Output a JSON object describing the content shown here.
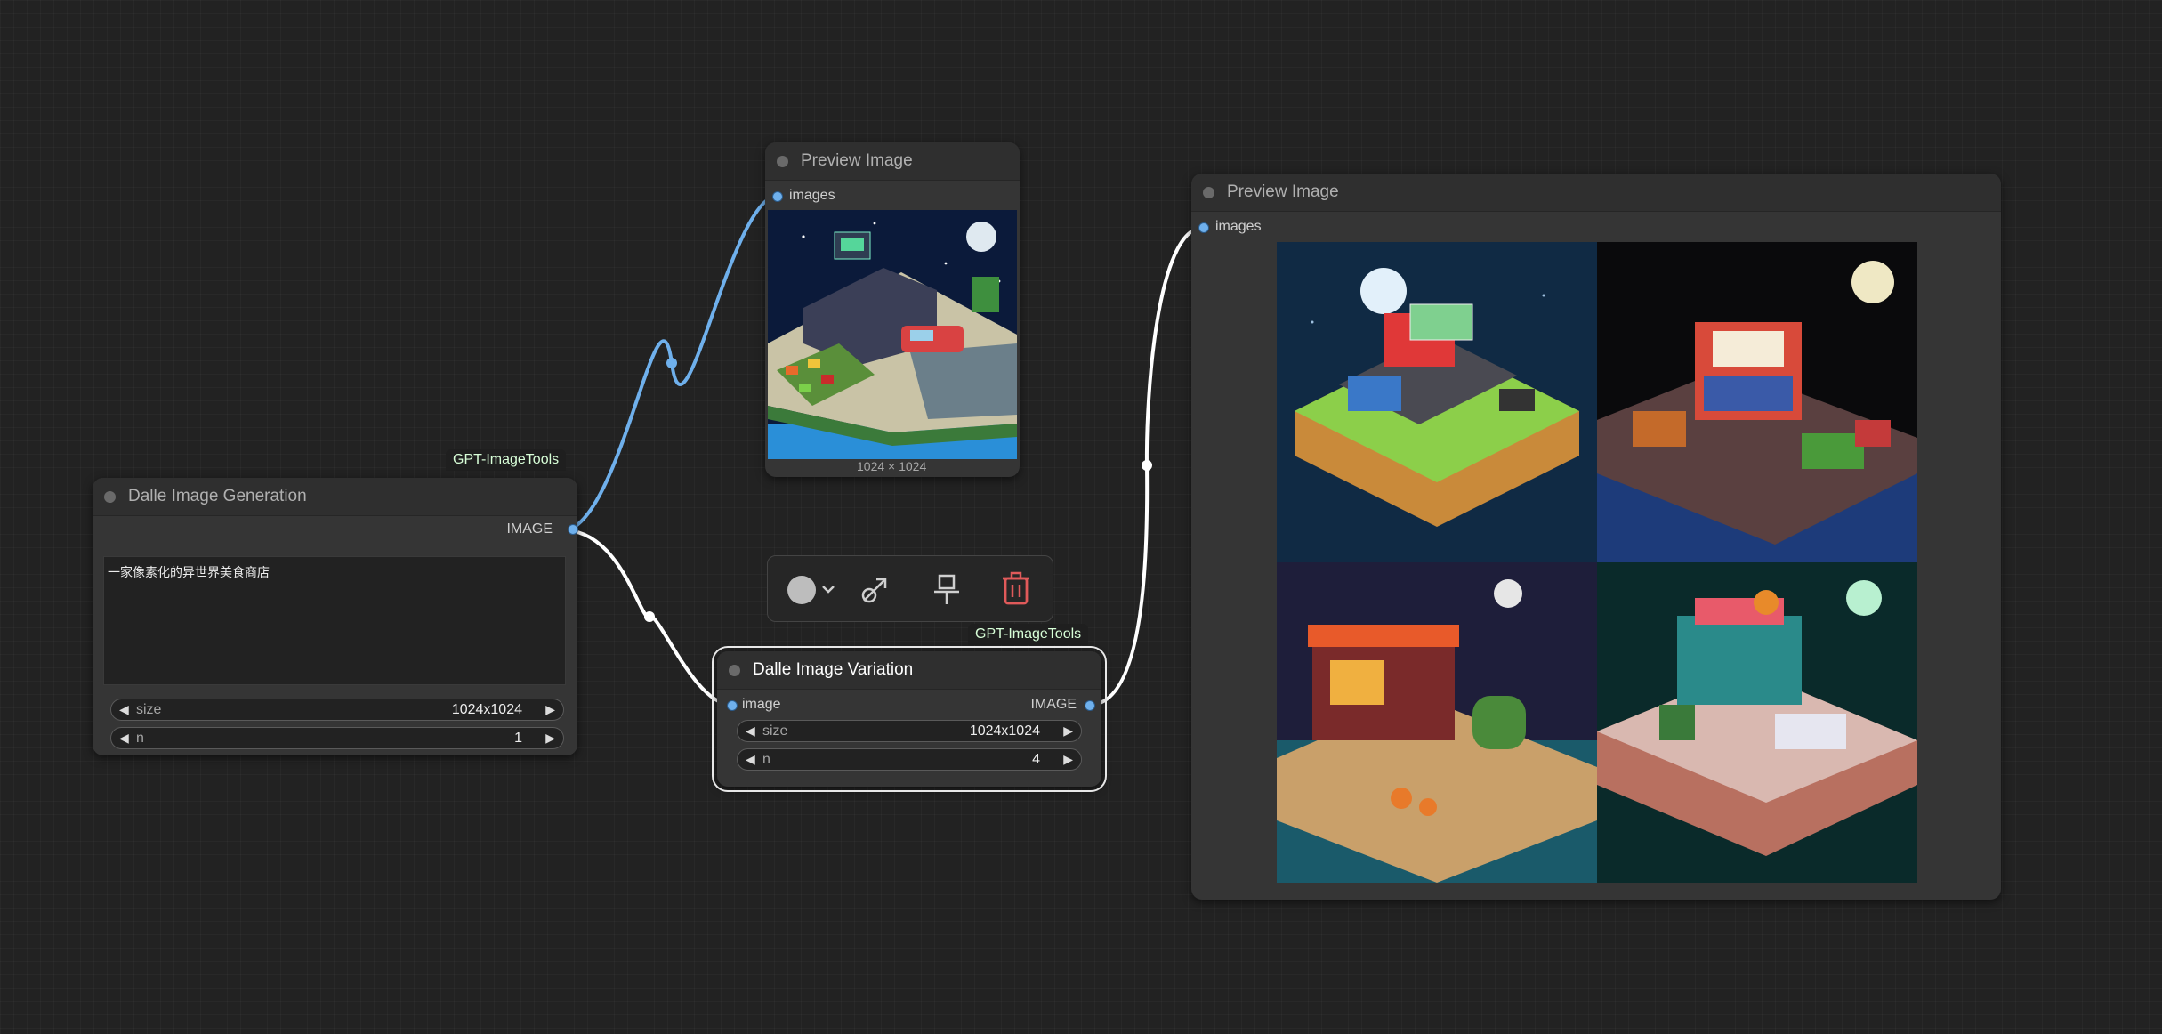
{
  "nodes": {
    "dalle_generation": {
      "title": "Dalle Image Generation",
      "badge": "GPT-ImageTools",
      "output_label": "IMAGE",
      "prompt": "一家像素化的异世界美食商店",
      "widgets": [
        {
          "label": "size",
          "value": "1024x1024"
        },
        {
          "label": "n",
          "value": "1"
        }
      ]
    },
    "preview_small": {
      "title": "Preview Image",
      "input_label": "images",
      "image_caption": "1024 × 1024",
      "image_subject": "pixel-art isometric night grocery store"
    },
    "dalle_variation": {
      "title": "Dalle Image Variation",
      "badge": "GPT-ImageTools",
      "input_label": "image",
      "output_label": "IMAGE",
      "widgets": [
        {
          "label": "size",
          "value": "1024x1024"
        },
        {
          "label": "n",
          "value": "4"
        }
      ]
    },
    "preview_large": {
      "title": "Preview Image",
      "input_label": "images",
      "image_subjects": [
        "isometric market stall with red awning, blue sky with moon",
        "isometric shop on dock at night with vegetables",
        "isometric food store with orange roof, pumpkins",
        "isometric teal shop with truck, green moon"
      ]
    }
  },
  "toolbar": {
    "buttons": [
      {
        "icon": "color-circle-icon"
      },
      {
        "icon": "bypass-icon"
      },
      {
        "icon": "pin-icon"
      },
      {
        "icon": "trash-icon"
      }
    ]
  },
  "colors": {
    "canvas": "#222222",
    "node": "#353535",
    "image_link": "#6fb0ec",
    "selected_link": "#ffffff",
    "delete": "#e05a5a",
    "badge_text": "#d8ffd8"
  }
}
